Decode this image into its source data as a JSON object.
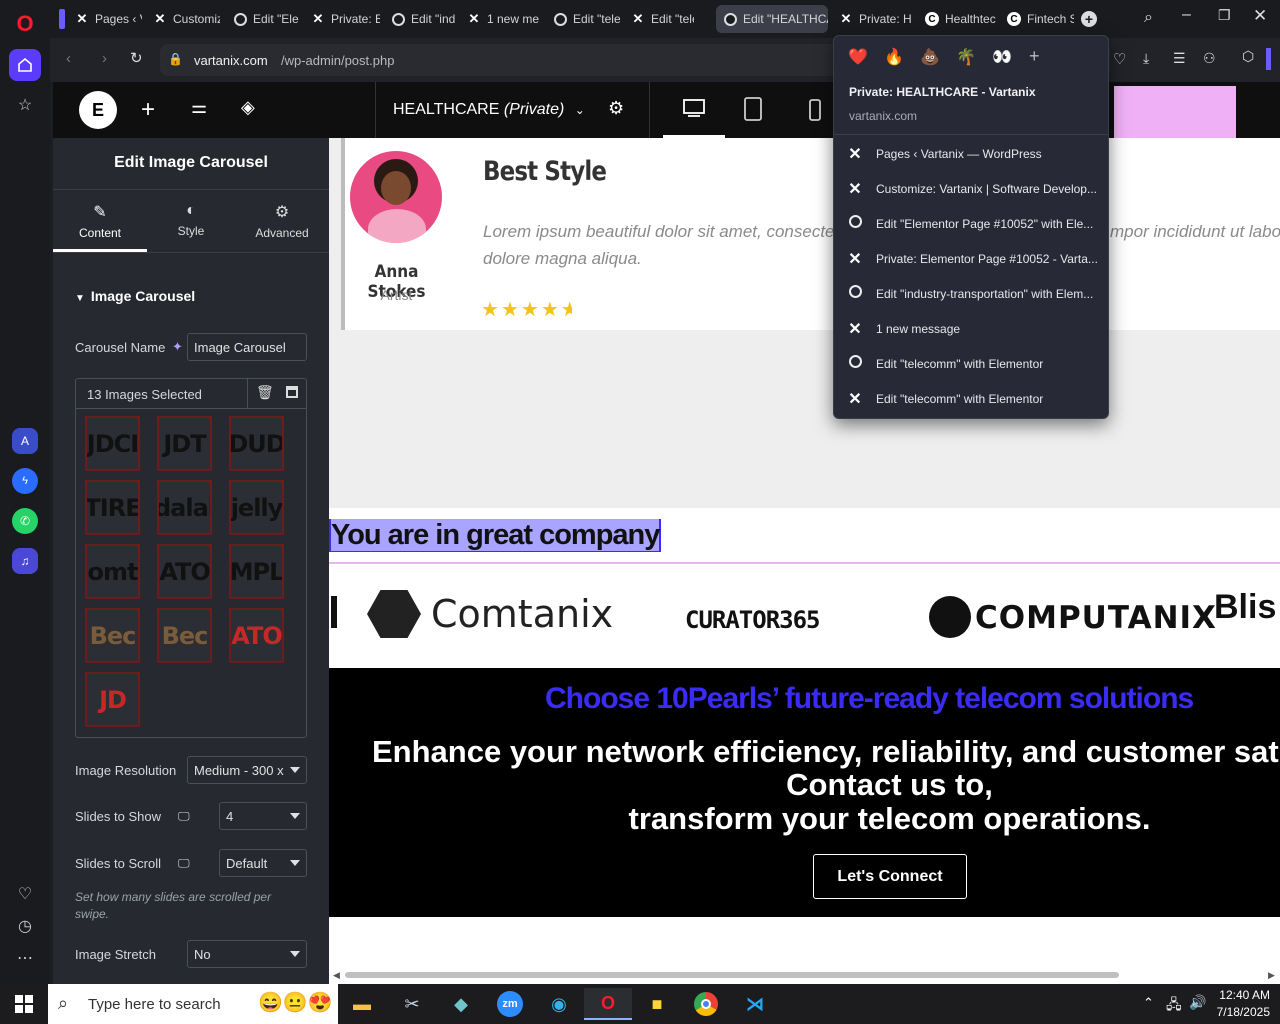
{
  "browser": {
    "tabs": [
      {
        "label": "Pages ‹ V",
        "icon": "x-logo-icon"
      },
      {
        "label": "Customiz",
        "icon": "x-logo-icon"
      },
      {
        "label": "Edit \"Ele",
        "icon": "globe-icon"
      },
      {
        "label": "Private: E",
        "icon": "x-logo-icon"
      },
      {
        "label": "Edit \"indu",
        "icon": "globe-icon"
      },
      {
        "label": "1 new me",
        "icon": "x-logo-icon"
      },
      {
        "label": "Edit \"tele",
        "icon": "globe-icon"
      },
      {
        "label": "Edit \"tele",
        "icon": "x-logo-icon"
      },
      {
        "label": "Edit \"HEALTHCA",
        "icon": "globe-icon",
        "active": true
      },
      {
        "label": "Private: H",
        "icon": "x-logo-icon"
      },
      {
        "label": "Healthtec",
        "icon": "c-logo-icon"
      },
      {
        "label": "Fintech S",
        "icon": "c-logo-icon"
      }
    ],
    "url_domain": "vartanix.com",
    "url_path": "/wp-admin/post.php"
  },
  "tab_popup": {
    "emojis": [
      "❤️",
      "🔥",
      "💩",
      "🌴",
      "👀"
    ],
    "title": "Private: HEALTHCARE - Vartanix",
    "domain": "vartanix.com",
    "items": [
      {
        "label": "Pages ‹ Vartanix — WordPress",
        "icon": "x-logo-icon"
      },
      {
        "label": "Customize: Vartanix | Software Develop...",
        "icon": "x-logo-icon"
      },
      {
        "label": "Edit \"Elementor Page #10052\" with Ele...",
        "icon": "globe-icon"
      },
      {
        "label": "Private: Elementor Page #10052 - Varta...",
        "icon": "x-logo-icon"
      },
      {
        "label": "Edit \"industry-transportation\" with Elem...",
        "icon": "globe-icon"
      },
      {
        "label": "1 new message",
        "icon": "x-logo-icon"
      },
      {
        "label": "Edit \"telecomm\" with Elementor",
        "icon": "globe-icon"
      },
      {
        "label": "Edit \"telecomm\" with Elementor",
        "icon": "x-logo-icon"
      }
    ]
  },
  "elementor": {
    "page_title": "HEALTHCARE",
    "page_status": "(Private)",
    "panel_title": "Edit Image Carousel",
    "tabs": [
      "Content",
      "Style",
      "Advanced"
    ],
    "section_title": "Image Carousel",
    "carousel_name_label": "Carousel Name",
    "carousel_name_value": "Image Carousel",
    "images_selected": "13 Images Selected",
    "thumbnails": [
      "JDCI",
      "JDT",
      "DUD",
      "TIRE",
      "dalal",
      "jelly",
      "omt",
      "ATO",
      "MPL",
      "Bec",
      "Bec",
      "ATO",
      "JD"
    ],
    "image_resolution_label": "Image Resolution",
    "image_resolution_value": "Medium - 300 x",
    "slides_to_show_label": "Slides to Show",
    "slides_to_show_value": "4",
    "slides_to_scroll_label": "Slides to Scroll",
    "slides_to_scroll_value": "Default",
    "slides_help": "Set how many slides are scrolled per swipe.",
    "image_stretch_label": "Image Stretch",
    "image_stretch_value": "No"
  },
  "canvas": {
    "testimonial_name": "Anna Stokes",
    "testimonial_role": "Artist",
    "testimonial_heading": "Best Style",
    "testimonial_text": "Lorem ipsum beautiful dolor sit amet, consecte",
    "testimonial_text_right": "mpor incididunt ut labo",
    "testimonial_text_line2": "dolore magna aliqua.",
    "rating_stars": 4.5,
    "company_heading": "You are in great company",
    "logos": [
      "Comtanix",
      "CURATOR365",
      "COMPUTANIX",
      "Blis"
    ],
    "cta_heading": "Choose 10Pearls’ future-ready telecom solutions",
    "cta_line1": "Enhance your network efficiency, reliability, and customer sati",
    "cta_line2": "Contact us to,",
    "cta_line3": "transform your telecom operations.",
    "cta_button": "Let's Connect"
  },
  "taskbar": {
    "search_placeholder": "Type here to search",
    "time": "12:40 AM",
    "date": "7/18/2025"
  },
  "colors": {
    "accent_purple": "#6a5cff",
    "cta_blue": "#3a2cf5",
    "star_gold": "#f0c419",
    "pink_block": "#efb0f5",
    "popup_bg": "#272a36"
  }
}
